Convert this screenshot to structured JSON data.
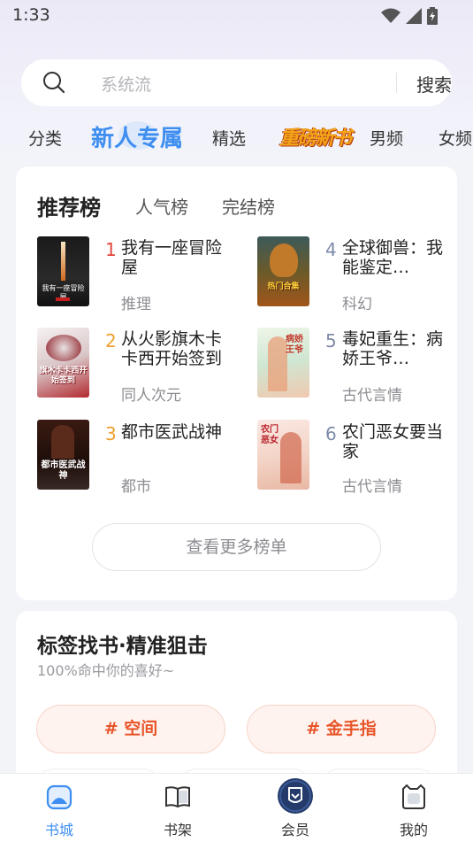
{
  "status": {
    "time": "1:33"
  },
  "search": {
    "placeholder": "系统流",
    "button": "搜索"
  },
  "tabs": [
    "分类",
    "新人专属",
    "精选",
    "重磅新书",
    "男频",
    "女频"
  ],
  "rank": {
    "tabs": [
      "推荐榜",
      "人气榜",
      "完结榜"
    ],
    "books": [
      {
        "rank": "1",
        "title": "我有一座冒险屋",
        "genre": "推理",
        "cover_text": "我有一座冒险屋"
      },
      {
        "rank": "2",
        "title": "从火影旗木卡卡西开始签到",
        "genre": "同人次元",
        "cover_text": "旗木卡卡西开始签到"
      },
      {
        "rank": "3",
        "title": "都市医武战神",
        "genre": "都市",
        "cover_text": "都市医武战神"
      },
      {
        "rank": "4",
        "title": "全球御兽：我能鉴定…",
        "genre": "科幻",
        "cover_text": "热门合集"
      },
      {
        "rank": "5",
        "title": "毒妃重生：病娇王爷…",
        "genre": "古代言情",
        "cover_text": "病娇王爷"
      },
      {
        "rank": "6",
        "title": "农门恶女要当家",
        "genre": "古代言情",
        "cover_text": "农门恶女"
      }
    ],
    "more": "查看更多榜单"
  },
  "tags": {
    "title": "标签找书·精准狙击",
    "subtitle": "100%命中你的喜好~",
    "chips": [
      "# 空间",
      "# 金手指"
    ]
  },
  "nav": [
    {
      "label": "书城",
      "active": true
    },
    {
      "label": "书架",
      "active": false
    },
    {
      "label": "会员",
      "active": false
    },
    {
      "label": "我的",
      "active": false
    }
  ],
  "colors": {
    "accent": "#3d8ef0",
    "tag": "#e8552a",
    "rank_top": "#e2463c",
    "rank_mid": "#f0a030",
    "rank_low": "#7d8aa8"
  }
}
